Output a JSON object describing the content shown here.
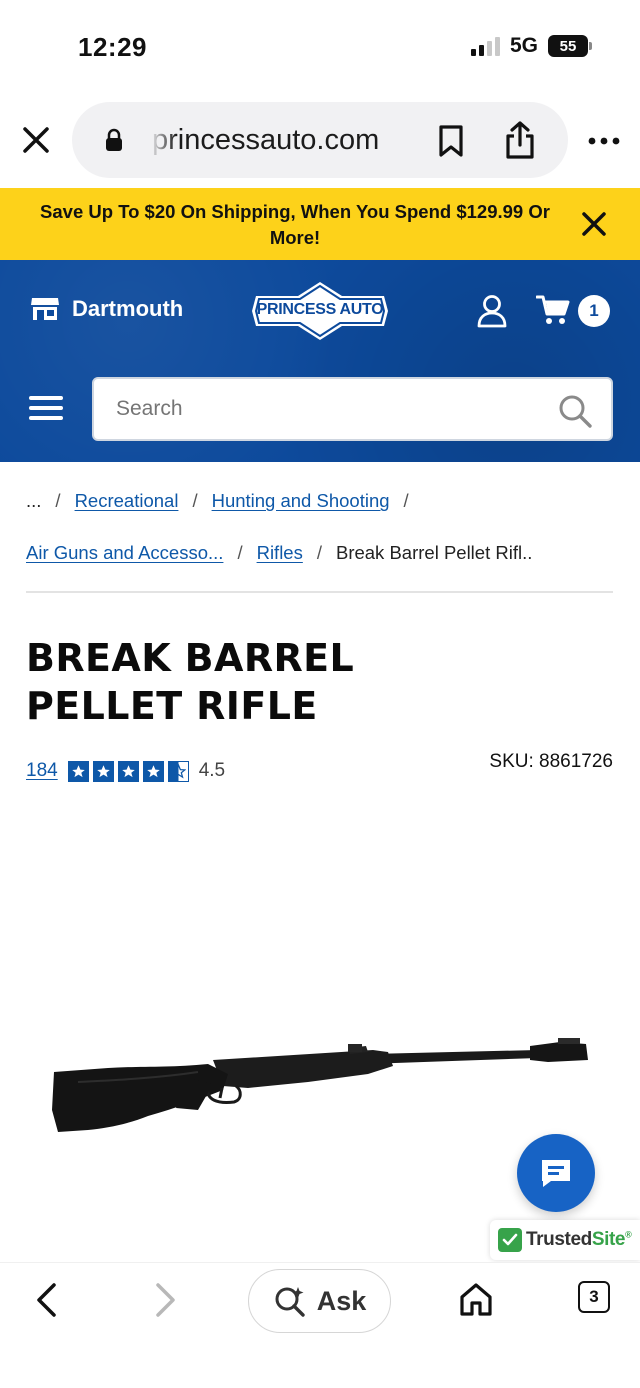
{
  "status_bar": {
    "time": "12:29",
    "network": "5G",
    "battery": "55"
  },
  "browser": {
    "url": "princessauto.com",
    "icons": [
      "close-icon",
      "lock-icon",
      "bookmark-icon",
      "share-icon",
      "more-icon"
    ]
  },
  "promo": {
    "text": "Save Up To $20 On Shipping, When You Spend $129.99 Or More!",
    "color": "#fdd21a"
  },
  "header": {
    "store_label": "Dartmouth",
    "logo_text": "PRINCESS AUTO",
    "cart_count": "1",
    "search_placeholder": "Search",
    "brand_color": "#0d4a9c"
  },
  "breadcrumb": {
    "ellipsis": "...",
    "items": [
      "Recreational",
      "Hunting and Shooting",
      "Air Guns and Accesso...",
      "Rifles"
    ],
    "current": "Break Barrel Pellet Rifl.."
  },
  "product": {
    "title_line1": "BREAK BARREL",
    "title_line2": "PELLET RIFLE",
    "review_count": "184",
    "rating": "4.5",
    "rating_fraction": 0.9,
    "sku": "SKU: 8861726"
  },
  "trusted": {
    "brand": "Trusted",
    "brand_suffix": "Site",
    "registered": "®"
  },
  "toolbar": {
    "ask_label": "Ask",
    "tab_count": "3"
  }
}
